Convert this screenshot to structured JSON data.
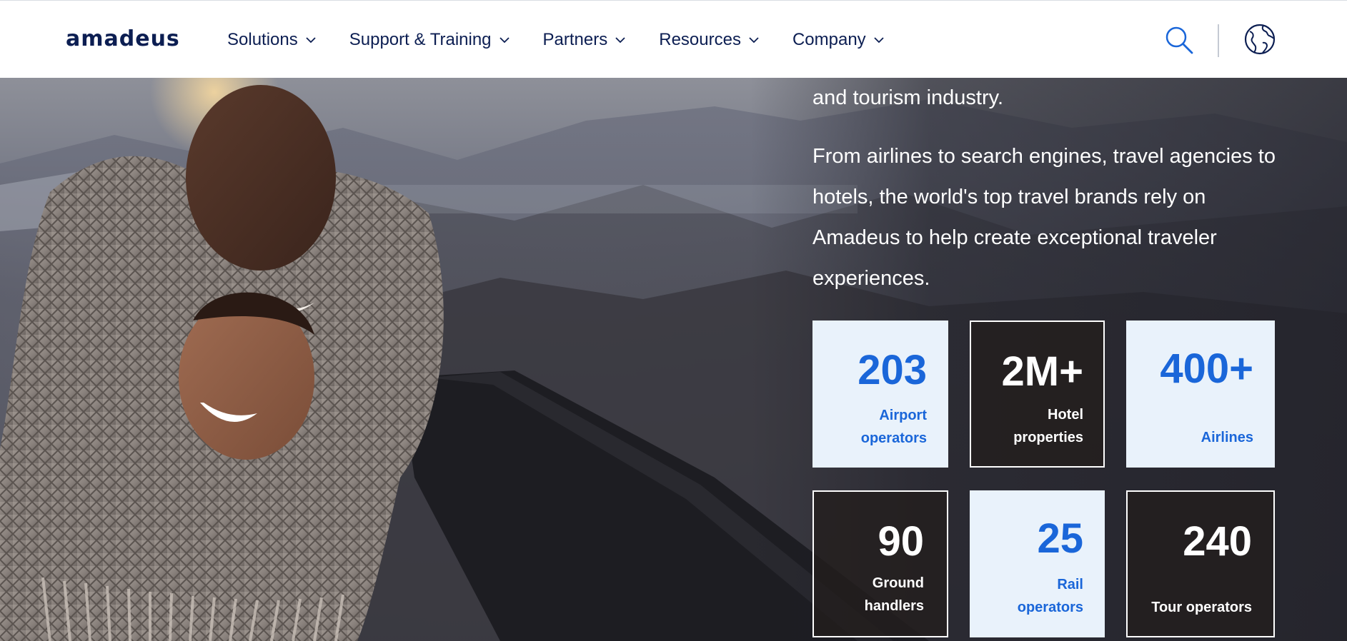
{
  "brand": {
    "logo_text": "amadeus",
    "color": "#0c1e52"
  },
  "nav": {
    "items": [
      {
        "label": "Solutions"
      },
      {
        "label": "Support & Training"
      },
      {
        "label": "Partners"
      },
      {
        "label": "Resources"
      },
      {
        "label": "Company"
      }
    ],
    "search_icon": "search-icon",
    "globe_icon": "globe-icon"
  },
  "hero": {
    "intro_tail": "and tourism industry.",
    "body": "From airlines to search engines, travel agencies to hotels, the world's top travel brands rely on Amadeus to help create exceptional traveler experiences."
  },
  "stats": [
    {
      "value": "203",
      "label": "Airport\noperators",
      "style": "light"
    },
    {
      "value": "2M+",
      "label": "Hotel\nproperties",
      "style": "dark"
    },
    {
      "value": "400+",
      "label": "Airlines",
      "style": "light"
    },
    {
      "value": "90",
      "label": "Ground\nhandlers",
      "style": "dark"
    },
    {
      "value": "25",
      "label": "Rail\noperators",
      "style": "light"
    },
    {
      "value": "240",
      "label": "Tour operators",
      "style": "dark"
    }
  ],
  "colors": {
    "accent": "#1a66d9",
    "stat_light_bg": "#e9f2fb",
    "nav_text": "#0c1e52"
  }
}
